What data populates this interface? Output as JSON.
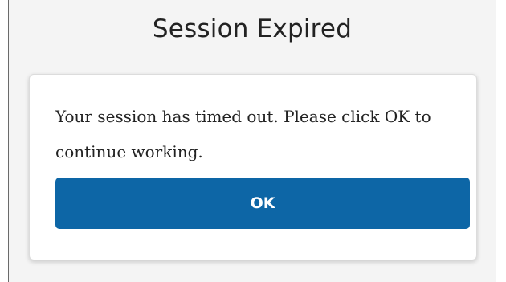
{
  "dialog": {
    "title": "Session Expired",
    "message": "Your session has timed out. Please click OK to continue working.",
    "ok_label": "OK"
  },
  "colors": {
    "background": "#f4f4f4",
    "card": "#ffffff",
    "button": "#0d66a6",
    "button_text": "#ffffff",
    "text": "#222222"
  }
}
